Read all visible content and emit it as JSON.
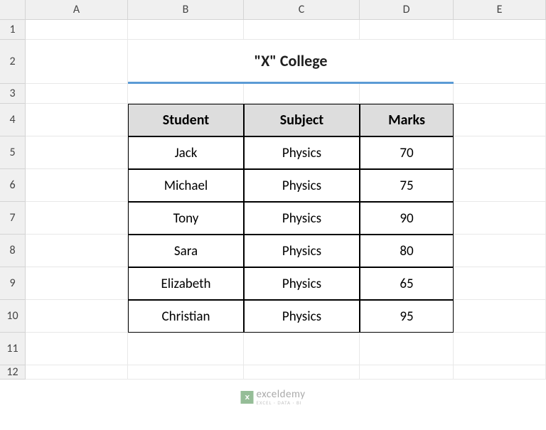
{
  "columns": [
    "A",
    "B",
    "C",
    "D",
    "E"
  ],
  "rows": [
    "1",
    "2",
    "3",
    "4",
    "5",
    "6",
    "7",
    "8",
    "9",
    "10",
    "11",
    "12"
  ],
  "title": "\"X\" College",
  "table": {
    "headers": [
      "Student",
      "Subject",
      "Marks"
    ],
    "data": [
      {
        "student": "Jack",
        "subject": "Physics",
        "marks": "70"
      },
      {
        "student": "Michael",
        "subject": "Physics",
        "marks": "75"
      },
      {
        "student": "Tony",
        "subject": "Physics",
        "marks": "90"
      },
      {
        "student": "Sara",
        "subject": "Physics",
        "marks": "80"
      },
      {
        "student": "Elizabeth",
        "subject": "Physics",
        "marks": "65"
      },
      {
        "student": "Christian",
        "subject": "Physics",
        "marks": "95"
      }
    ]
  },
  "watermark": {
    "main": "exceldemy",
    "sub": "EXCEL · DATA · BI"
  }
}
